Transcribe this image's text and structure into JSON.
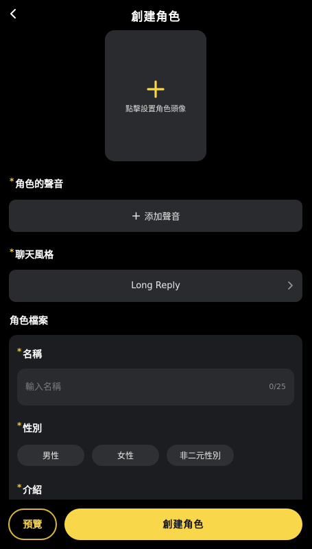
{
  "header": {
    "title": "創建角色"
  },
  "avatar": {
    "hint": "點擊設置角色頭像"
  },
  "voice": {
    "label": "角色的聲音",
    "required_mark": "*",
    "add_label": "添加聲音"
  },
  "chat_style": {
    "label": "聊天風格",
    "required_mark": "*",
    "value": "Long Reply"
  },
  "profile": {
    "section_label": "角色檔案",
    "name": {
      "label": "名稱",
      "required_mark": "*",
      "placeholder": "輸入名稱",
      "value": "",
      "count": "0/25"
    },
    "gender": {
      "label": "性別",
      "required_mark": "*",
      "options": [
        "男性",
        "女性",
        "非二元性別"
      ]
    },
    "intro": {
      "label": "介紹",
      "required_mark": "*"
    }
  },
  "footer": {
    "preview_label": "預覽",
    "create_label": "創建角色"
  },
  "colors": {
    "background": "#000000",
    "card": "#2a2b2e",
    "panel": "#1c1d20",
    "accent": "#f8d74a",
    "required": "#f5c842"
  },
  "icons": {
    "back": "chevron-left-icon",
    "add_avatar": "plus-icon",
    "chat_style_arrow": "chevron-right-icon"
  }
}
